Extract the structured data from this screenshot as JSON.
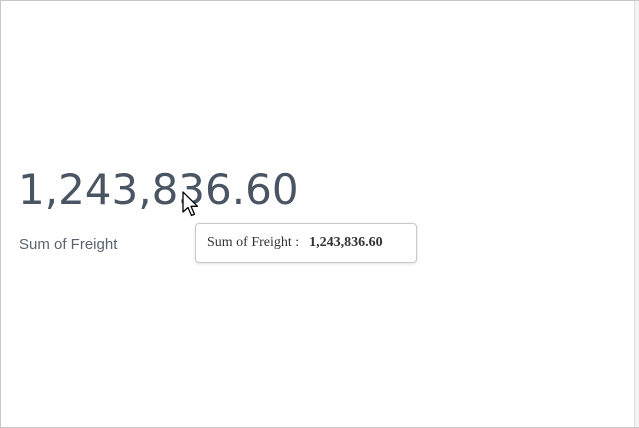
{
  "kpi": {
    "value": "1,243,836.60",
    "label": "Sum of Freight"
  },
  "tooltip": {
    "label": "Sum of Freight :",
    "value": "1,243,836.60"
  },
  "cursor": {
    "icon": "mouse-pointer-icon"
  },
  "colors": {
    "value_text": "#4a5563",
    "label_text": "#5a6370",
    "tooltip_border": "#c9c9c9"
  }
}
